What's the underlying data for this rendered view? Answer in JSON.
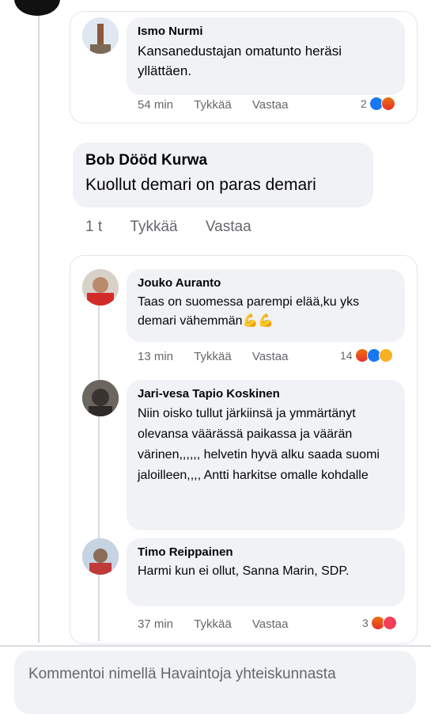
{
  "comments": [
    {
      "name": "Ismo Nurmi",
      "text": "Kansanedustajan omatunto heräsi yllättäen.",
      "time": "54 min",
      "like": "Tykkää",
      "reply": "Vastaa",
      "reaction_count": "2",
      "reactions": [
        "like",
        "angry"
      ]
    },
    {
      "name": "Bob Dööd Kurwa",
      "text": "Kuollut demari on paras demari",
      "time": "1 t",
      "like": "Tykkää",
      "reply": "Vastaa"
    },
    {
      "name": "Jouko Auranto",
      "text": "Taas on suomessa parempi elää,ku yks demari vähemmän💪💪",
      "time": "13 min",
      "like": "Tykkää",
      "reply": "Vastaa",
      "reaction_count": "14",
      "reactions": [
        "angry",
        "like",
        "haha"
      ]
    },
    {
      "name": "Jari-vesa Tapio Koskinen",
      "text": "Niin oisko tullut järkiinsä ja ymmärtänyt olevansa väärässä paikassa ja väärän värinen,,,,,, helvetin hyvä alku saada suomi jaloilleen,,,, Antti harkitse omalle kohdalle"
    },
    {
      "name": "Timo Reippainen",
      "text": "Harmi kun ei ollut, Sanna Marin, SDP.",
      "time": "37 min",
      "like": "Tykkää",
      "reply": "Vastaa",
      "reaction_count": "3",
      "reactions": [
        "angry",
        "heart"
      ]
    }
  ],
  "composer": {
    "placeholder": "Kommentoi nimellä Havaintoja yhteiskunnasta"
  }
}
